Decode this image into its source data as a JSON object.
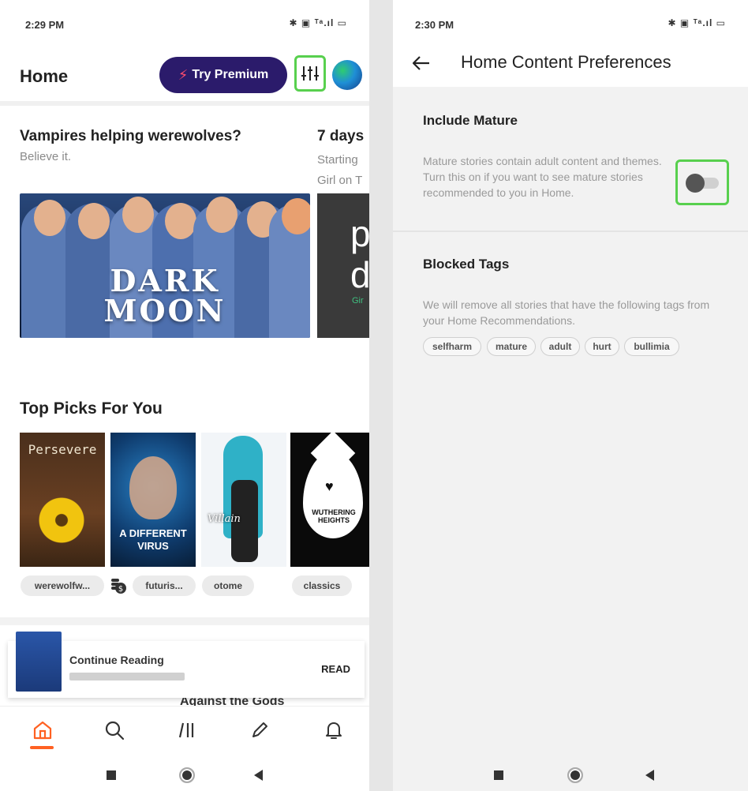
{
  "left": {
    "status": {
      "time": "2:29 PM",
      "icons": "✱ ▣ ᵀᵃ.ıl ▭"
    },
    "header": {
      "title": "Home",
      "premium_label": "Try Premium"
    },
    "features": [
      {
        "title": "Vampires helping werewolves?",
        "subtitle": "Believe it.",
        "banner_line1": "DARK",
        "banner_line2": "MOON"
      },
      {
        "title": "7 days",
        "subtitle_line1": "Starting",
        "subtitle_line2": "Girl on T",
        "banner_text_line1": "p",
        "banner_text_line2": "d",
        "banner_small": "Gir"
      }
    ],
    "top_picks": {
      "title": "Top Picks For You",
      "covers": [
        {
          "title": "Persevere"
        },
        {
          "title": "A DIFFERENT VIRUS"
        },
        {
          "title": "Villain"
        },
        {
          "title": "WUTHERING HEIGHTS"
        }
      ],
      "tags": [
        "werewolfw...",
        "futuris...",
        "otome",
        "classics"
      ]
    },
    "continue_reading": {
      "title": "Continue Reading",
      "action": "READ",
      "under_text": "Against the Gods"
    }
  },
  "right": {
    "status": {
      "time": "2:30 PM",
      "icons": "✱ ▣ ᵀᵃ.ıl ▭"
    },
    "header": {
      "title": "Home Content Preferences"
    },
    "mature": {
      "title": "Include Mature",
      "description": "Mature stories contain adult content and themes. Turn this on if you want to see mature stories recommended to you in Home.",
      "enabled": false
    },
    "blocked": {
      "title": "Blocked Tags",
      "description": "We will remove all stories that have the following tags from your Home Recommendations.",
      "tags": [
        "selfharm",
        "mature",
        "adult",
        "hurt",
        "bullimia"
      ]
    }
  },
  "colors": {
    "premium": "#2b1b6b",
    "accent": "#ff6122",
    "highlight": "#58d04e"
  }
}
